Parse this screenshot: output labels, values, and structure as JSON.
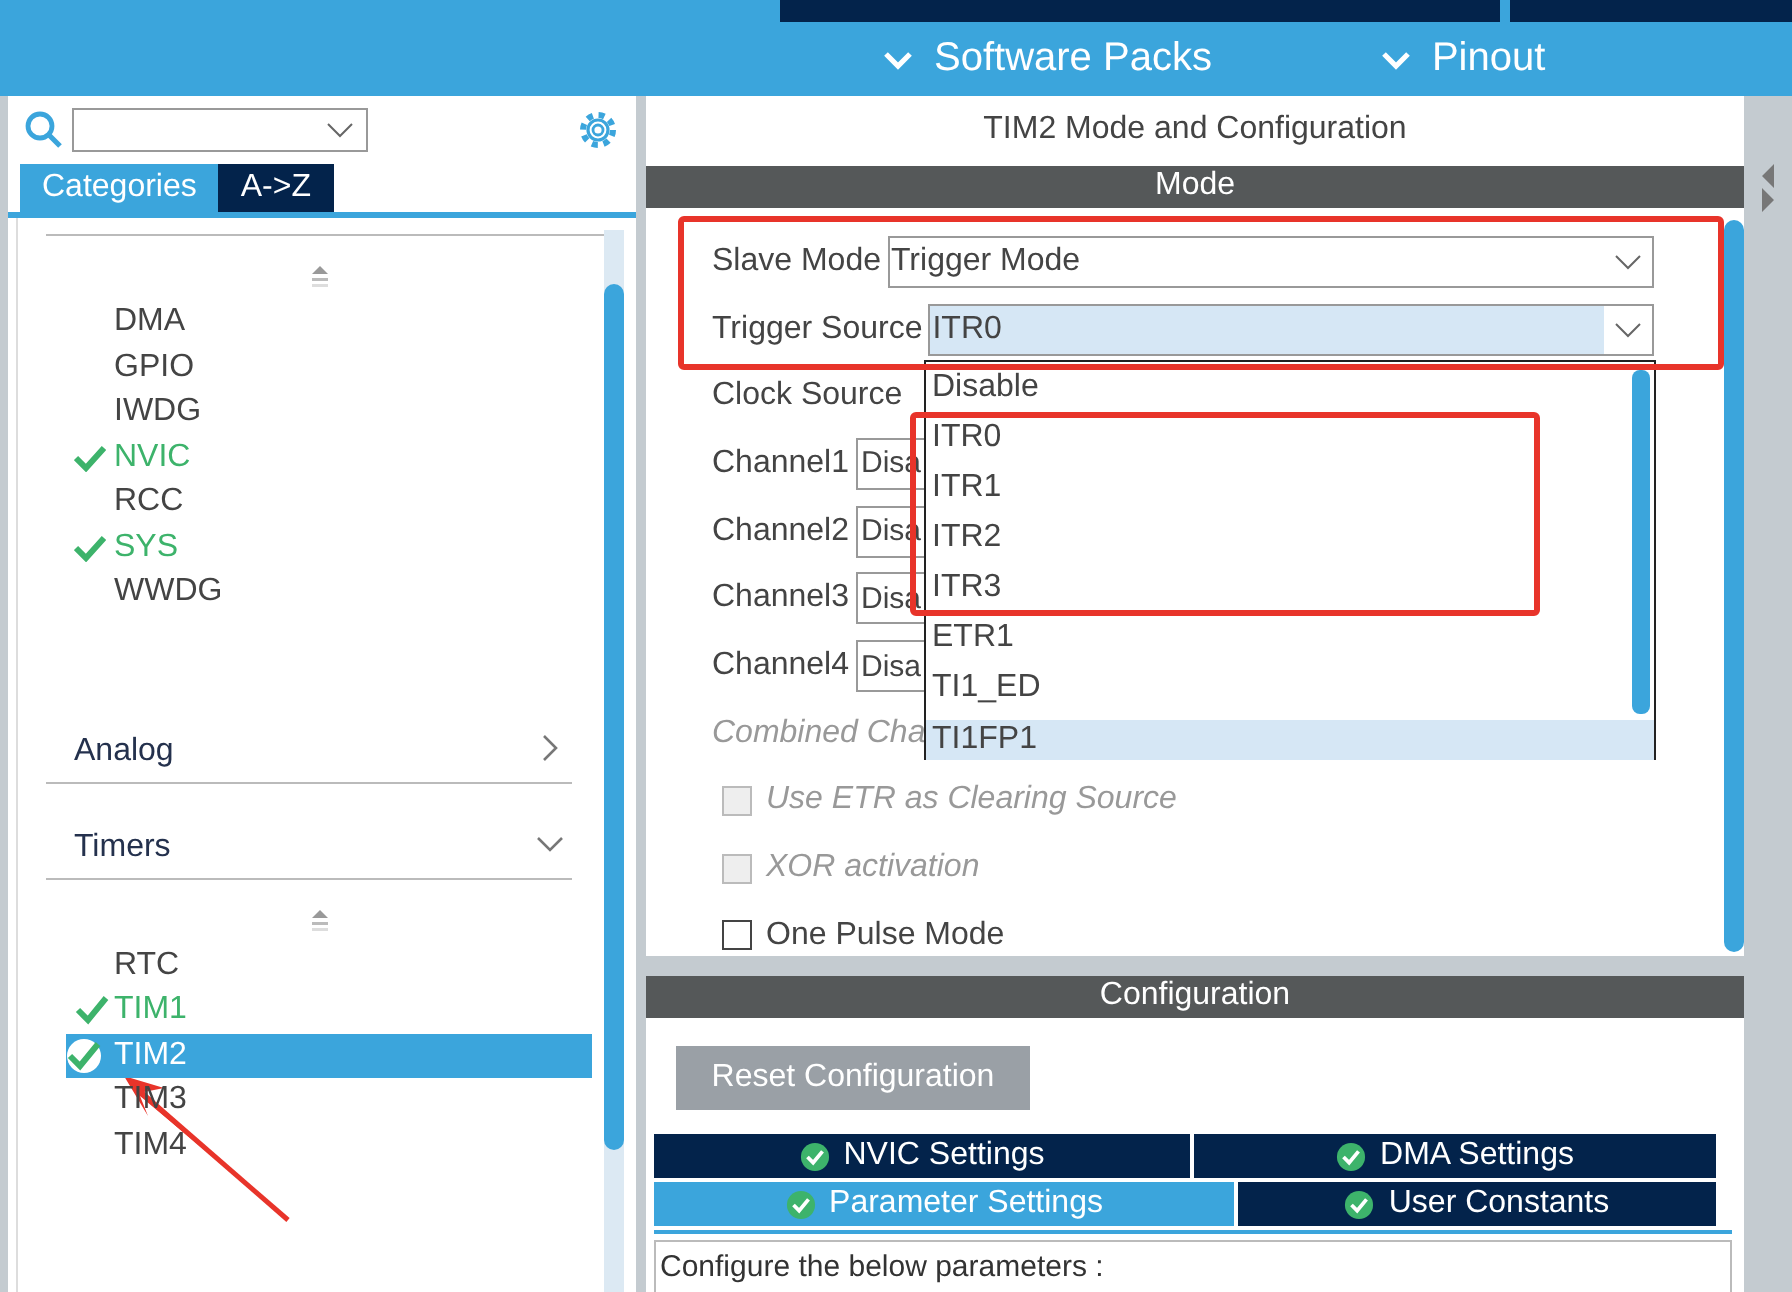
{
  "header": {
    "nav": [
      {
        "label": "Software Packs"
      },
      {
        "label": "Pinout"
      }
    ]
  },
  "sidebar": {
    "tabs": [
      {
        "label": "Categories",
        "selected": true
      },
      {
        "label": "A->Z",
        "selected": false
      }
    ],
    "items": [
      {
        "label": "DMA",
        "checked": false,
        "selected": false
      },
      {
        "label": "GPIO",
        "checked": false,
        "selected": false
      },
      {
        "label": "IWDG",
        "checked": false,
        "selected": false
      },
      {
        "label": "NVIC",
        "checked": true,
        "selected": false
      },
      {
        "label": "RCC",
        "checked": false,
        "selected": false
      },
      {
        "label": "SYS",
        "checked": true,
        "selected": false
      },
      {
        "label": "WWDG",
        "checked": false,
        "selected": false
      }
    ],
    "categories": [
      {
        "label": "Analog",
        "expanded": false
      },
      {
        "label": "Timers",
        "expanded": true,
        "items": [
          {
            "label": "RTC",
            "checked": false,
            "selected": false
          },
          {
            "label": "TIM1",
            "checked": true,
            "selected": false
          },
          {
            "label": "TIM2",
            "checked": true,
            "selected": true
          },
          {
            "label": "TIM3",
            "checked": false,
            "selected": false
          },
          {
            "label": "TIM4",
            "checked": false,
            "selected": false
          }
        ]
      }
    ]
  },
  "panel": {
    "title": "TIM2 Mode and Configuration",
    "mode_header": "Mode",
    "fields": [
      {
        "kind": "select",
        "label": "Slave Mode",
        "value": "Trigger Mode",
        "focused": false
      },
      {
        "kind": "select",
        "label": "Trigger Source",
        "value": "ITR0",
        "focused": true
      },
      {
        "kind": "label",
        "label": "Clock Source",
        "disabled": false
      },
      {
        "kind": "short",
        "label": "Channel1",
        "value": "Disa"
      },
      {
        "kind": "short",
        "label": "Channel2",
        "value": "Disa"
      },
      {
        "kind": "short",
        "label": "Channel3",
        "value": "Disa"
      },
      {
        "kind": "short",
        "label": "Channel4",
        "value": "Disa"
      },
      {
        "kind": "label",
        "label": "Combined Cha",
        "disabled": true
      },
      {
        "kind": "checkbox",
        "label": "Use ETR as Clearing Source",
        "checked": false,
        "disabled": true
      },
      {
        "kind": "checkbox",
        "label": "XOR activation",
        "checked": false,
        "disabled": true
      },
      {
        "kind": "checkbox",
        "label": "One Pulse Mode",
        "checked": false,
        "disabled": false
      }
    ],
    "dropdown": [
      {
        "label": "Disable",
        "hovered": false
      },
      {
        "label": "ITR0",
        "hovered": false
      },
      {
        "label": "ITR1",
        "hovered": false
      },
      {
        "label": "ITR2",
        "hovered": false
      },
      {
        "label": "ITR3",
        "hovered": false
      },
      {
        "label": "ETR1",
        "hovered": false
      },
      {
        "label": "TI1_ED",
        "hovered": false
      },
      {
        "label": "TI1FP1",
        "hovered": true
      }
    ],
    "config_header": "Configuration",
    "reset_button": "Reset Configuration",
    "tab_rows": [
      {
        "tabs": [
          {
            "label": "NVIC Settings",
            "selected": false
          },
          {
            "label": "DMA Settings",
            "selected": false
          }
        ]
      },
      {
        "tabs": [
          {
            "label": "Parameter Settings",
            "selected": true
          },
          {
            "label": "User Constants",
            "selected": false
          }
        ]
      }
    ],
    "description": "Configure the below parameters :"
  }
}
